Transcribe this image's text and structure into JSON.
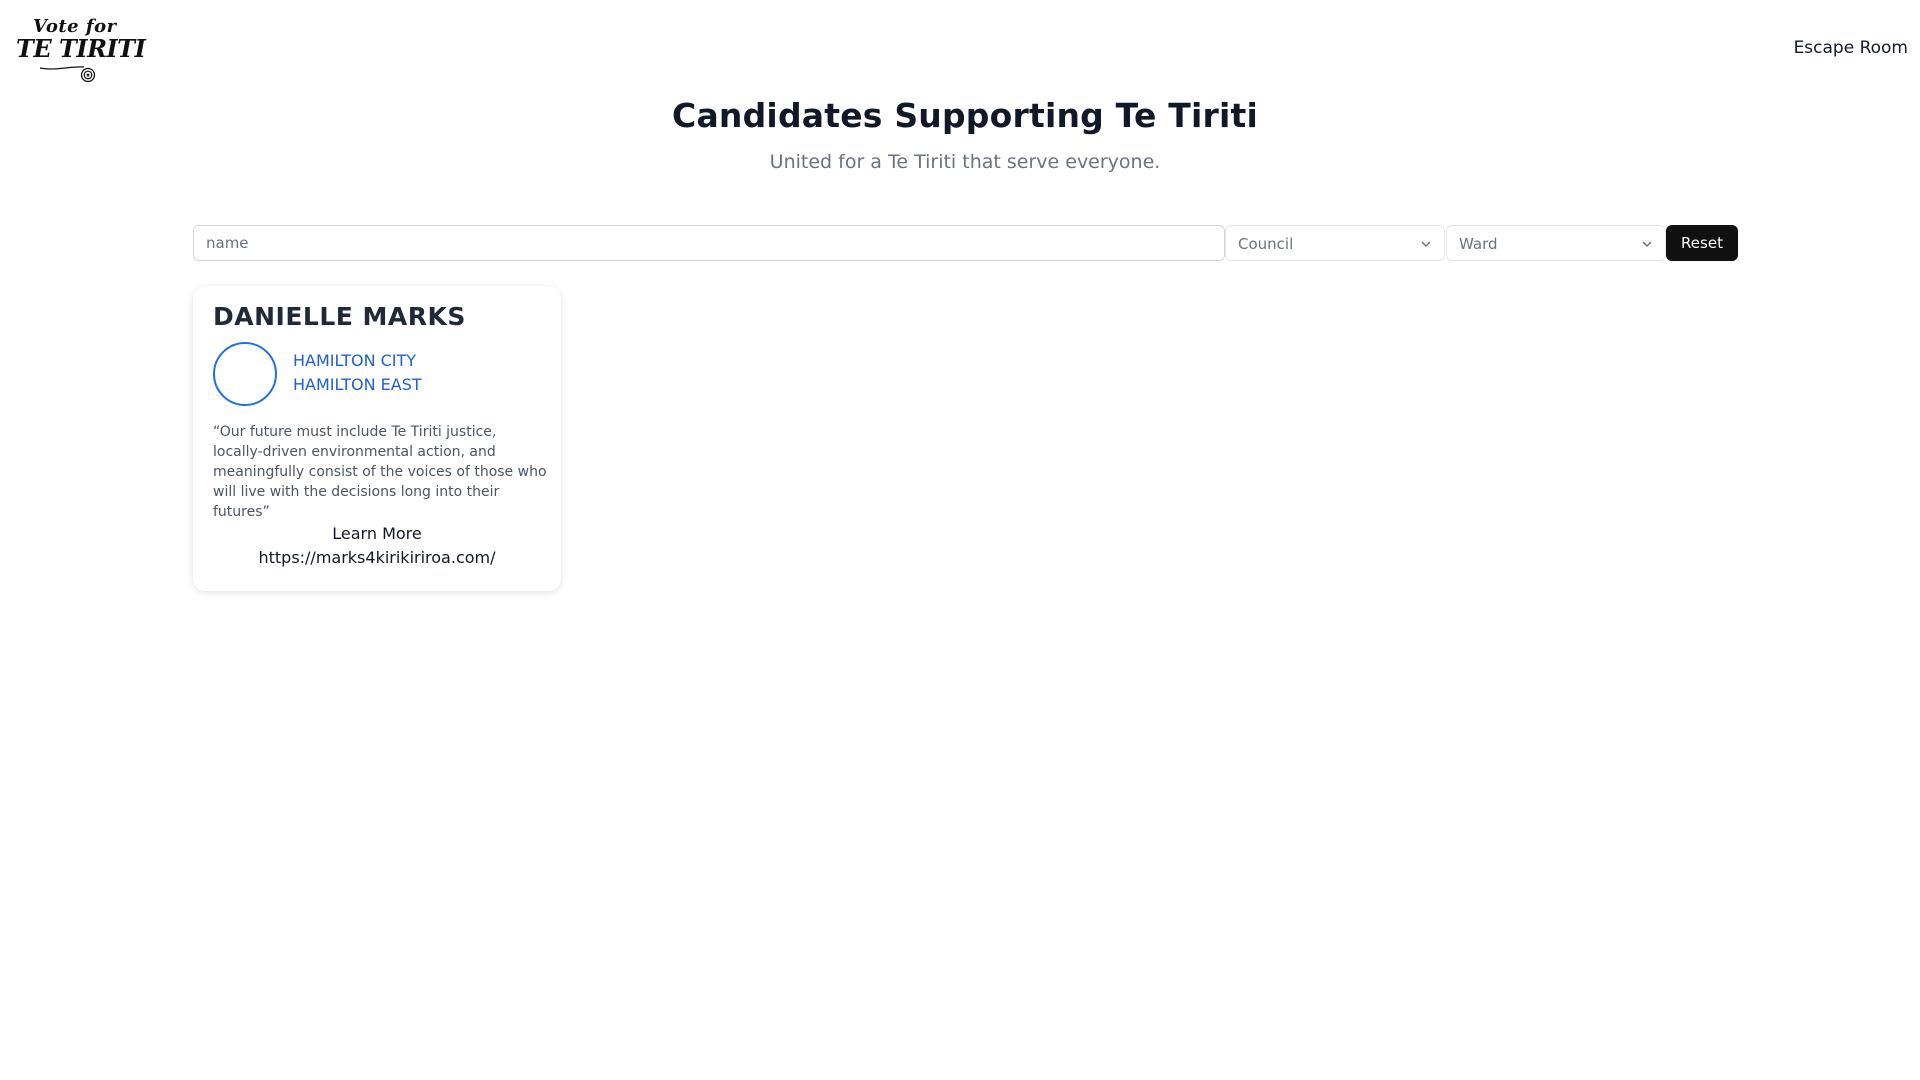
{
  "header": {
    "logo_top": "Vote for",
    "logo_main": "TE TIRITI",
    "nav_link": "Escape Room"
  },
  "hero": {
    "title": "Candidates Supporting Te Tiriti",
    "subtitle": "United for a Te Tiriti that serve everyone."
  },
  "filters": {
    "name_placeholder": "name",
    "council_label": "Council",
    "ward_label": "Ward",
    "reset_label": "Reset"
  },
  "candidates": [
    {
      "name": "DANIELLE MARKS",
      "council": "HAMILTON CITY",
      "ward": "HAMILTON EAST",
      "quote": "“Our future must include Te Tiriti justice, locally-driven environmental action, and meaningfully consist of the voices of those who will live with the decisions long into their futures”",
      "learn_more": "Learn More",
      "website": "https://marks4kirikiriroa.com/"
    }
  ],
  "colors": {
    "accent_blue": "#1d5fd6",
    "button_dark": "#111111",
    "muted_text": "#6b7280"
  },
  "icons": {
    "select_chevron": "chevron-down-icon"
  }
}
